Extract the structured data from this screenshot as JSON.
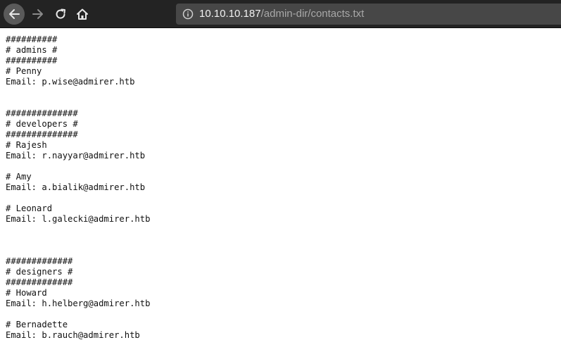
{
  "browser": {
    "url_host": "10.10.10.187",
    "url_path": "/admin-dir/contacts.txt",
    "icons": {
      "back": "arrow-left-icon",
      "forward": "arrow-right-icon",
      "reload": "reload-icon",
      "home": "home-icon",
      "site_info": "info-circle-icon"
    }
  },
  "document": {
    "text": "##########\n# admins #\n##########\n# Penny\nEmail: p.wise@admirer.htb\n\n\n##############\n# developers #\n##############\n# Rajesh\nEmail: r.nayyar@admirer.htb\n\n# Amy\nEmail: a.bialik@admirer.htb\n\n# Leonard\nEmail: l.galecki@admirer.htb\n\n\n\n#############\n# designers #\n#############\n# Howard\nEmail: h.helberg@admirer.htb\n\n# Bernadette\nEmail: b.rauch@admirer.htb"
  }
}
